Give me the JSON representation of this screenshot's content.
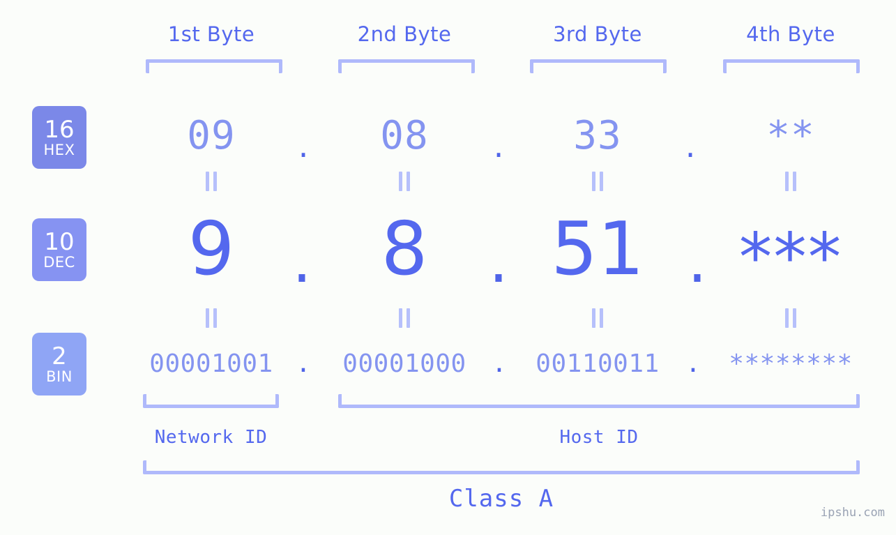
{
  "page": {
    "background": "#fbfdfa",
    "accent": "#5468ee",
    "accent_light": "#8494f0",
    "bracket_color": "#afb9fb",
    "watermark": "ipshu.com"
  },
  "byte_headers": [
    {
      "label": "1st Byte"
    },
    {
      "label": "2nd Byte"
    },
    {
      "label": "3rd Byte"
    },
    {
      "label": "4th Byte"
    }
  ],
  "bases": [
    {
      "num": "16",
      "label": "HEX",
      "color": "#7b88e8"
    },
    {
      "num": "10",
      "label": "DEC",
      "color": "#8693f2"
    },
    {
      "num": "2",
      "label": "BIN",
      "color": "#8fa5f5"
    }
  ],
  "rows": {
    "hex": {
      "values": [
        "09",
        "08",
        "33",
        "**"
      ],
      "separator": "."
    },
    "dec": {
      "values": [
        "9",
        "8",
        "51",
        "***"
      ],
      "separator": "."
    },
    "bin": {
      "values": [
        "00001001",
        "00001000",
        "00110011",
        "********"
      ],
      "separator": "."
    }
  },
  "segments": {
    "network_id": "Network ID",
    "host_id": "Host ID",
    "class": "Class A"
  }
}
